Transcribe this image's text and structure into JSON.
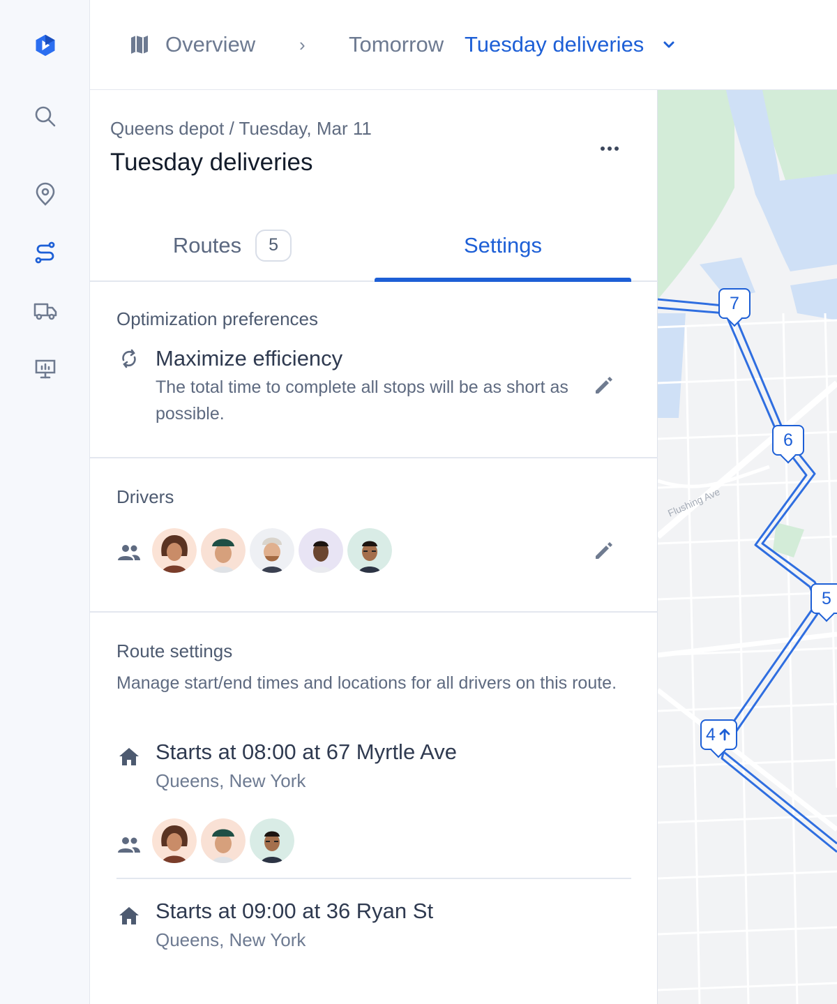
{
  "nav": {
    "items": [
      "logo",
      "search",
      "locations",
      "routes",
      "vehicles",
      "reports"
    ],
    "active": "routes"
  },
  "breadcrumb": {
    "overview": "Overview",
    "separator": "›",
    "tomorrow": "Tomorrow",
    "plan": "Tuesday deliveries"
  },
  "header": {
    "subtitle": "Queens depot / Tuesday, Mar 11",
    "title": "Tuesday deliveries"
  },
  "tabs": {
    "routes_label": "Routes",
    "routes_count": "5",
    "settings_label": "Settings",
    "active": "settings"
  },
  "optimization": {
    "label": "Optimization preferences",
    "title": "Maximize efficiency",
    "description": "The total time to complete all stops will be as short as possible."
  },
  "drivers": {
    "label": "Drivers",
    "count": 5
  },
  "route_settings": {
    "label": "Route settings",
    "description": "Manage start/end times and locations for all drivers on this route.",
    "starts": [
      {
        "title": "Starts at 08:00 at 67 Myrtle Ave",
        "location": "Queens, New York",
        "driver_count": 3
      },
      {
        "title": "Starts at 09:00 at 36 Ryan St",
        "location": "Queens, New York"
      }
    ]
  },
  "map": {
    "street_label": "Flushing Ave",
    "stops": [
      {
        "label": "7"
      },
      {
        "label": "6"
      },
      {
        "label": "5"
      },
      {
        "label": "4",
        "icon": "arrow-up-icon"
      }
    ]
  },
  "colors": {
    "accent": "#1d5fd6",
    "park": "#d3ecd8",
    "water": "#cfe0f6",
    "route": "#2f6ee0"
  }
}
